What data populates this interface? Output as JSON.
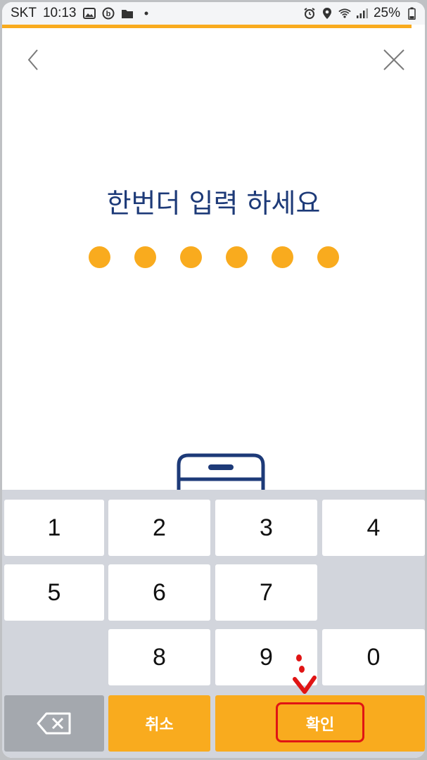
{
  "status_bar": {
    "carrier": "SKT",
    "time": "10:13",
    "battery": "25%",
    "left_icons": [
      "image-icon",
      "b-app-icon",
      "folder-icon",
      "dot-icon"
    ],
    "right_icons": [
      "alarm-icon",
      "location-icon",
      "wifi-icon",
      "signal-icon",
      "battery-icon"
    ]
  },
  "colors": {
    "accent": "#f9ab1e",
    "title": "#1d3a78",
    "keypad_bg": "#d2d5dc",
    "highlight": "#e01414"
  },
  "header": {
    "back_icon": "chevron-left-icon",
    "close_icon": "close-icon"
  },
  "main": {
    "title": "한번더 입력 하세요",
    "pin_length": 6,
    "pin_filled": 6
  },
  "keypad": {
    "keys": [
      "1",
      "2",
      "3",
      "4",
      "5",
      "6",
      "7",
      "8",
      "9",
      "0"
    ],
    "cancel_label": "취소",
    "confirm_label": "확인",
    "backspace_icon": "backspace-icon"
  }
}
